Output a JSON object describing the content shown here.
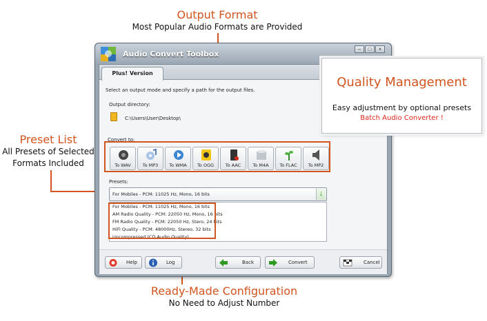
{
  "callouts": {
    "output_format": {
      "title": "Output Format",
      "subtitle": "Most Popular Audio Formats are Provided"
    },
    "preset_list": {
      "title": "Preset List",
      "line1": "All Presets of Selected",
      "line2": "Formats Included"
    },
    "ready_made": {
      "title": "Ready-Made Configuration",
      "subtitle": "No Need to Adjust Number"
    },
    "quality": {
      "title": "Quality Management",
      "subtitle": "Easy adjustment by optional presets",
      "tagline": "Batch Audio Converter !"
    }
  },
  "colors": {
    "accent": "#d2541f",
    "tagline": "#e0241b"
  },
  "window": {
    "title": "Audio Convert Toolbox",
    "tab": "Plus! Version",
    "instruction": "Select an output mode and specify a path for the output files.",
    "output_dir_label": "Output directory:",
    "output_dir_value": "C:\\Users\\User\\Desktop\\",
    "convert_to_label": "Convert to:",
    "formats": [
      {
        "label": "To WAV",
        "icon": "speaker-disc-icon"
      },
      {
        "label": "To MP3",
        "icon": "cd-music-note-icon"
      },
      {
        "label": "To WMA",
        "icon": "media-player-icon"
      },
      {
        "label": "To OGG",
        "icon": "yellow-speaker-icon"
      },
      {
        "label": "To AAC",
        "icon": "aac-device-icon"
      },
      {
        "label": "To M4A",
        "icon": "m4a-box-icon"
      },
      {
        "label": "To FLAC",
        "icon": "flac-plant-icon"
      },
      {
        "label": "To MP2",
        "icon": "loudspeaker-icon"
      }
    ],
    "presets_label": "Presets:",
    "preset_selected": "For Mobiles - PCM: 11025 Hz, Mono, 16 bits",
    "preset_options": [
      "For Mobiles - PCM: 11025 Hz, Mono, 16 bits",
      "AM Radio Quality - PCM: 22050 Hz, Mono, 16 bits",
      "FM Radio Quality - PCM: 22050 Hz, Stero, 24 bits",
      "HiFi Quality - PCM: 48000Hz, Stereo, 32 bits",
      "Uncompressed (CD Audio Quality)"
    ],
    "buttons": {
      "help": "Help",
      "log": "Log",
      "back": "Back",
      "convert": "Convert",
      "cancel": "Cancel"
    }
  }
}
